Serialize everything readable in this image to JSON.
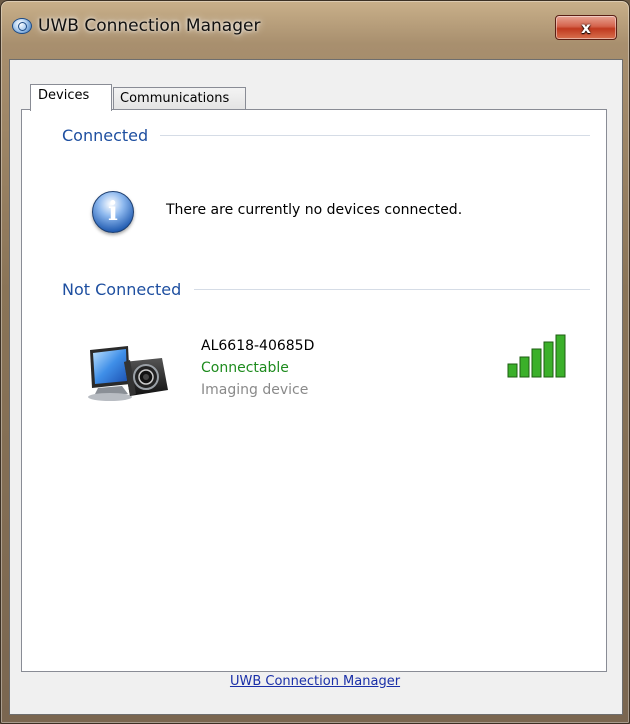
{
  "window": {
    "title": "UWB Connection Manager",
    "close_label": "x"
  },
  "tabs": [
    {
      "label": "Devices",
      "active": true
    },
    {
      "label": "Communications",
      "active": false
    }
  ],
  "connected": {
    "heading": "Connected",
    "message": "There are currently no devices connected."
  },
  "not_connected": {
    "heading": "Not Connected",
    "devices": [
      {
        "name": "AL6618-40685D",
        "status": "Connectable",
        "type": "Imaging device",
        "signal_bars": 5,
        "signal_max": 5
      }
    ]
  },
  "footer": {
    "link_label": "UWB Connection Manager"
  },
  "colors": {
    "heading": "#1e4fa0",
    "connectable": "#1e8b1e",
    "device_type": "#8a8a8a",
    "link": "#1a2fa8",
    "signal": "#3bb02a"
  }
}
